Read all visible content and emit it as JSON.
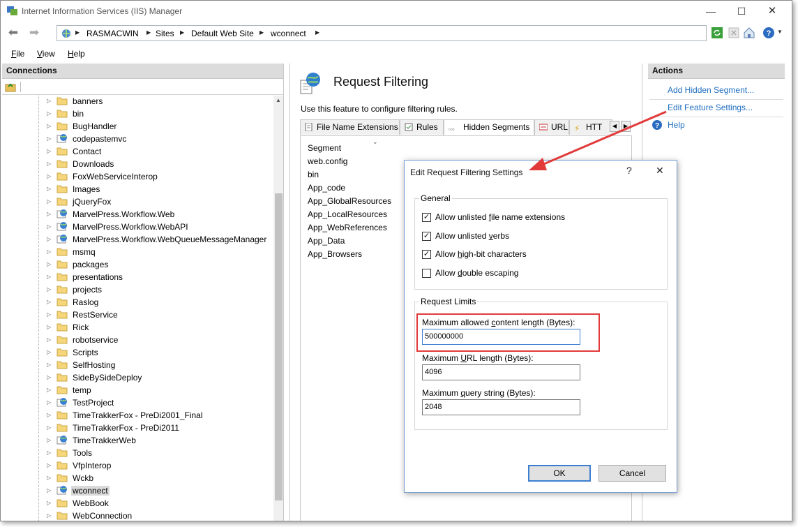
{
  "window": {
    "title": "Internet Information Services (IIS) Manager",
    "controls": {
      "minimize": "—",
      "maximize": "☐",
      "close": "✕"
    }
  },
  "address": {
    "crumbs": [
      "RASMACWIN",
      "Sites",
      "Default Web Site",
      "wconnect"
    ],
    "icons": [
      "globe-icon",
      "refresh-icon",
      "stop-icon",
      "home-icon",
      "help-icon"
    ]
  },
  "menu": {
    "file": {
      "accel": "F",
      "rest": "ile"
    },
    "view": {
      "accel": "V",
      "rest": "iew"
    },
    "help": {
      "accel": "H",
      "rest": "elp"
    }
  },
  "connections": {
    "header": "Connections",
    "items": [
      {
        "label": "banners",
        "type": "folder"
      },
      {
        "label": "bin",
        "type": "folder"
      },
      {
        "label": "BugHandler",
        "type": "folder"
      },
      {
        "label": "codepastemvc",
        "type": "app"
      },
      {
        "label": "Contact",
        "type": "folder"
      },
      {
        "label": "Downloads",
        "type": "folder"
      },
      {
        "label": "FoxWebServiceInterop",
        "type": "folder"
      },
      {
        "label": "Images",
        "type": "folder"
      },
      {
        "label": "jQueryFox",
        "type": "folder"
      },
      {
        "label": "MarvelPress.Workflow.Web",
        "type": "app"
      },
      {
        "label": "MarvelPress.Workflow.WebAPI",
        "type": "app"
      },
      {
        "label": "MarvelPress.Workflow.WebQueueMessageManager",
        "type": "app"
      },
      {
        "label": "msmq",
        "type": "folder"
      },
      {
        "label": "packages",
        "type": "folder"
      },
      {
        "label": "presentations",
        "type": "folder"
      },
      {
        "label": "projects",
        "type": "folder"
      },
      {
        "label": "Raslog",
        "type": "folder"
      },
      {
        "label": "RestService",
        "type": "folder"
      },
      {
        "label": "Rick",
        "type": "folder"
      },
      {
        "label": "robotservice",
        "type": "folder"
      },
      {
        "label": "Scripts",
        "type": "folder"
      },
      {
        "label": "SelfHosting",
        "type": "folder"
      },
      {
        "label": "SideBySideDeploy",
        "type": "folder"
      },
      {
        "label": "temp",
        "type": "folder"
      },
      {
        "label": "TestProject",
        "type": "app"
      },
      {
        "label": "TimeTrakkerFox - PreDi2001_Final",
        "type": "folder"
      },
      {
        "label": "TimeTrakkerFox - PreDi2011",
        "type": "folder"
      },
      {
        "label": "TimeTrakkerWeb",
        "type": "app"
      },
      {
        "label": "Tools",
        "type": "folder"
      },
      {
        "label": "VfpInterop",
        "type": "folder"
      },
      {
        "label": "Wckb",
        "type": "folder"
      },
      {
        "label": "wconnect",
        "type": "app",
        "selected": true
      },
      {
        "label": "WebBook",
        "type": "folder"
      },
      {
        "label": "WebConnection",
        "type": "folder"
      }
    ]
  },
  "feature": {
    "title": "Request Filtering",
    "description": "Use this feature to configure filtering rules.",
    "tabs": [
      "File Name Extensions",
      "Rules",
      "Hidden Segments",
      "URL",
      "HTT"
    ],
    "active_tab": "Hidden Segments",
    "column_header": "Segment",
    "segments": [
      "web.config",
      "bin",
      "App_code",
      "App_GlobalResources",
      "App_LocalResources",
      "App_WebReferences",
      "App_Data",
      "App_Browsers"
    ]
  },
  "actions": {
    "header": "Actions",
    "add_hidden_segment": "Add Hidden Segment...",
    "edit_feature_settings": "Edit Feature Settings...",
    "help": "Help"
  },
  "dialog": {
    "title": "Edit Request Filtering Settings",
    "help_glyph": "?",
    "close_glyph": "✕",
    "general_title": "General",
    "checks": [
      {
        "pre": "Allow unlisted ",
        "accel": "f",
        "post": "ile name extensions",
        "checked": true
      },
      {
        "pre": "Allow unlisted ",
        "accel": "v",
        "post": "erbs",
        "checked": true
      },
      {
        "pre": "Allow ",
        "accel": "h",
        "post": "igh-bit characters",
        "checked": true
      },
      {
        "pre": "Allow ",
        "accel": "d",
        "post": "ouble escaping",
        "checked": false
      }
    ],
    "limits_title": "Request Limits",
    "max_content": {
      "pre": "Maximum allowed ",
      "accel": "c",
      "post": "ontent length (Bytes):",
      "value": "500000000"
    },
    "max_url": {
      "pre": "Maximum ",
      "accel": "U",
      "post": "RL length (Bytes):",
      "value": "4096"
    },
    "max_query": {
      "pre": "Maximum ",
      "accel": "q",
      "post": "uery string (Bytes):",
      "value": "2048"
    },
    "ok_label": "OK",
    "cancel_label": "Cancel"
  },
  "colors": {
    "link": "#1f6fc0",
    "annotation": "#e23a3a",
    "panel_header": "#dcdcdc"
  }
}
